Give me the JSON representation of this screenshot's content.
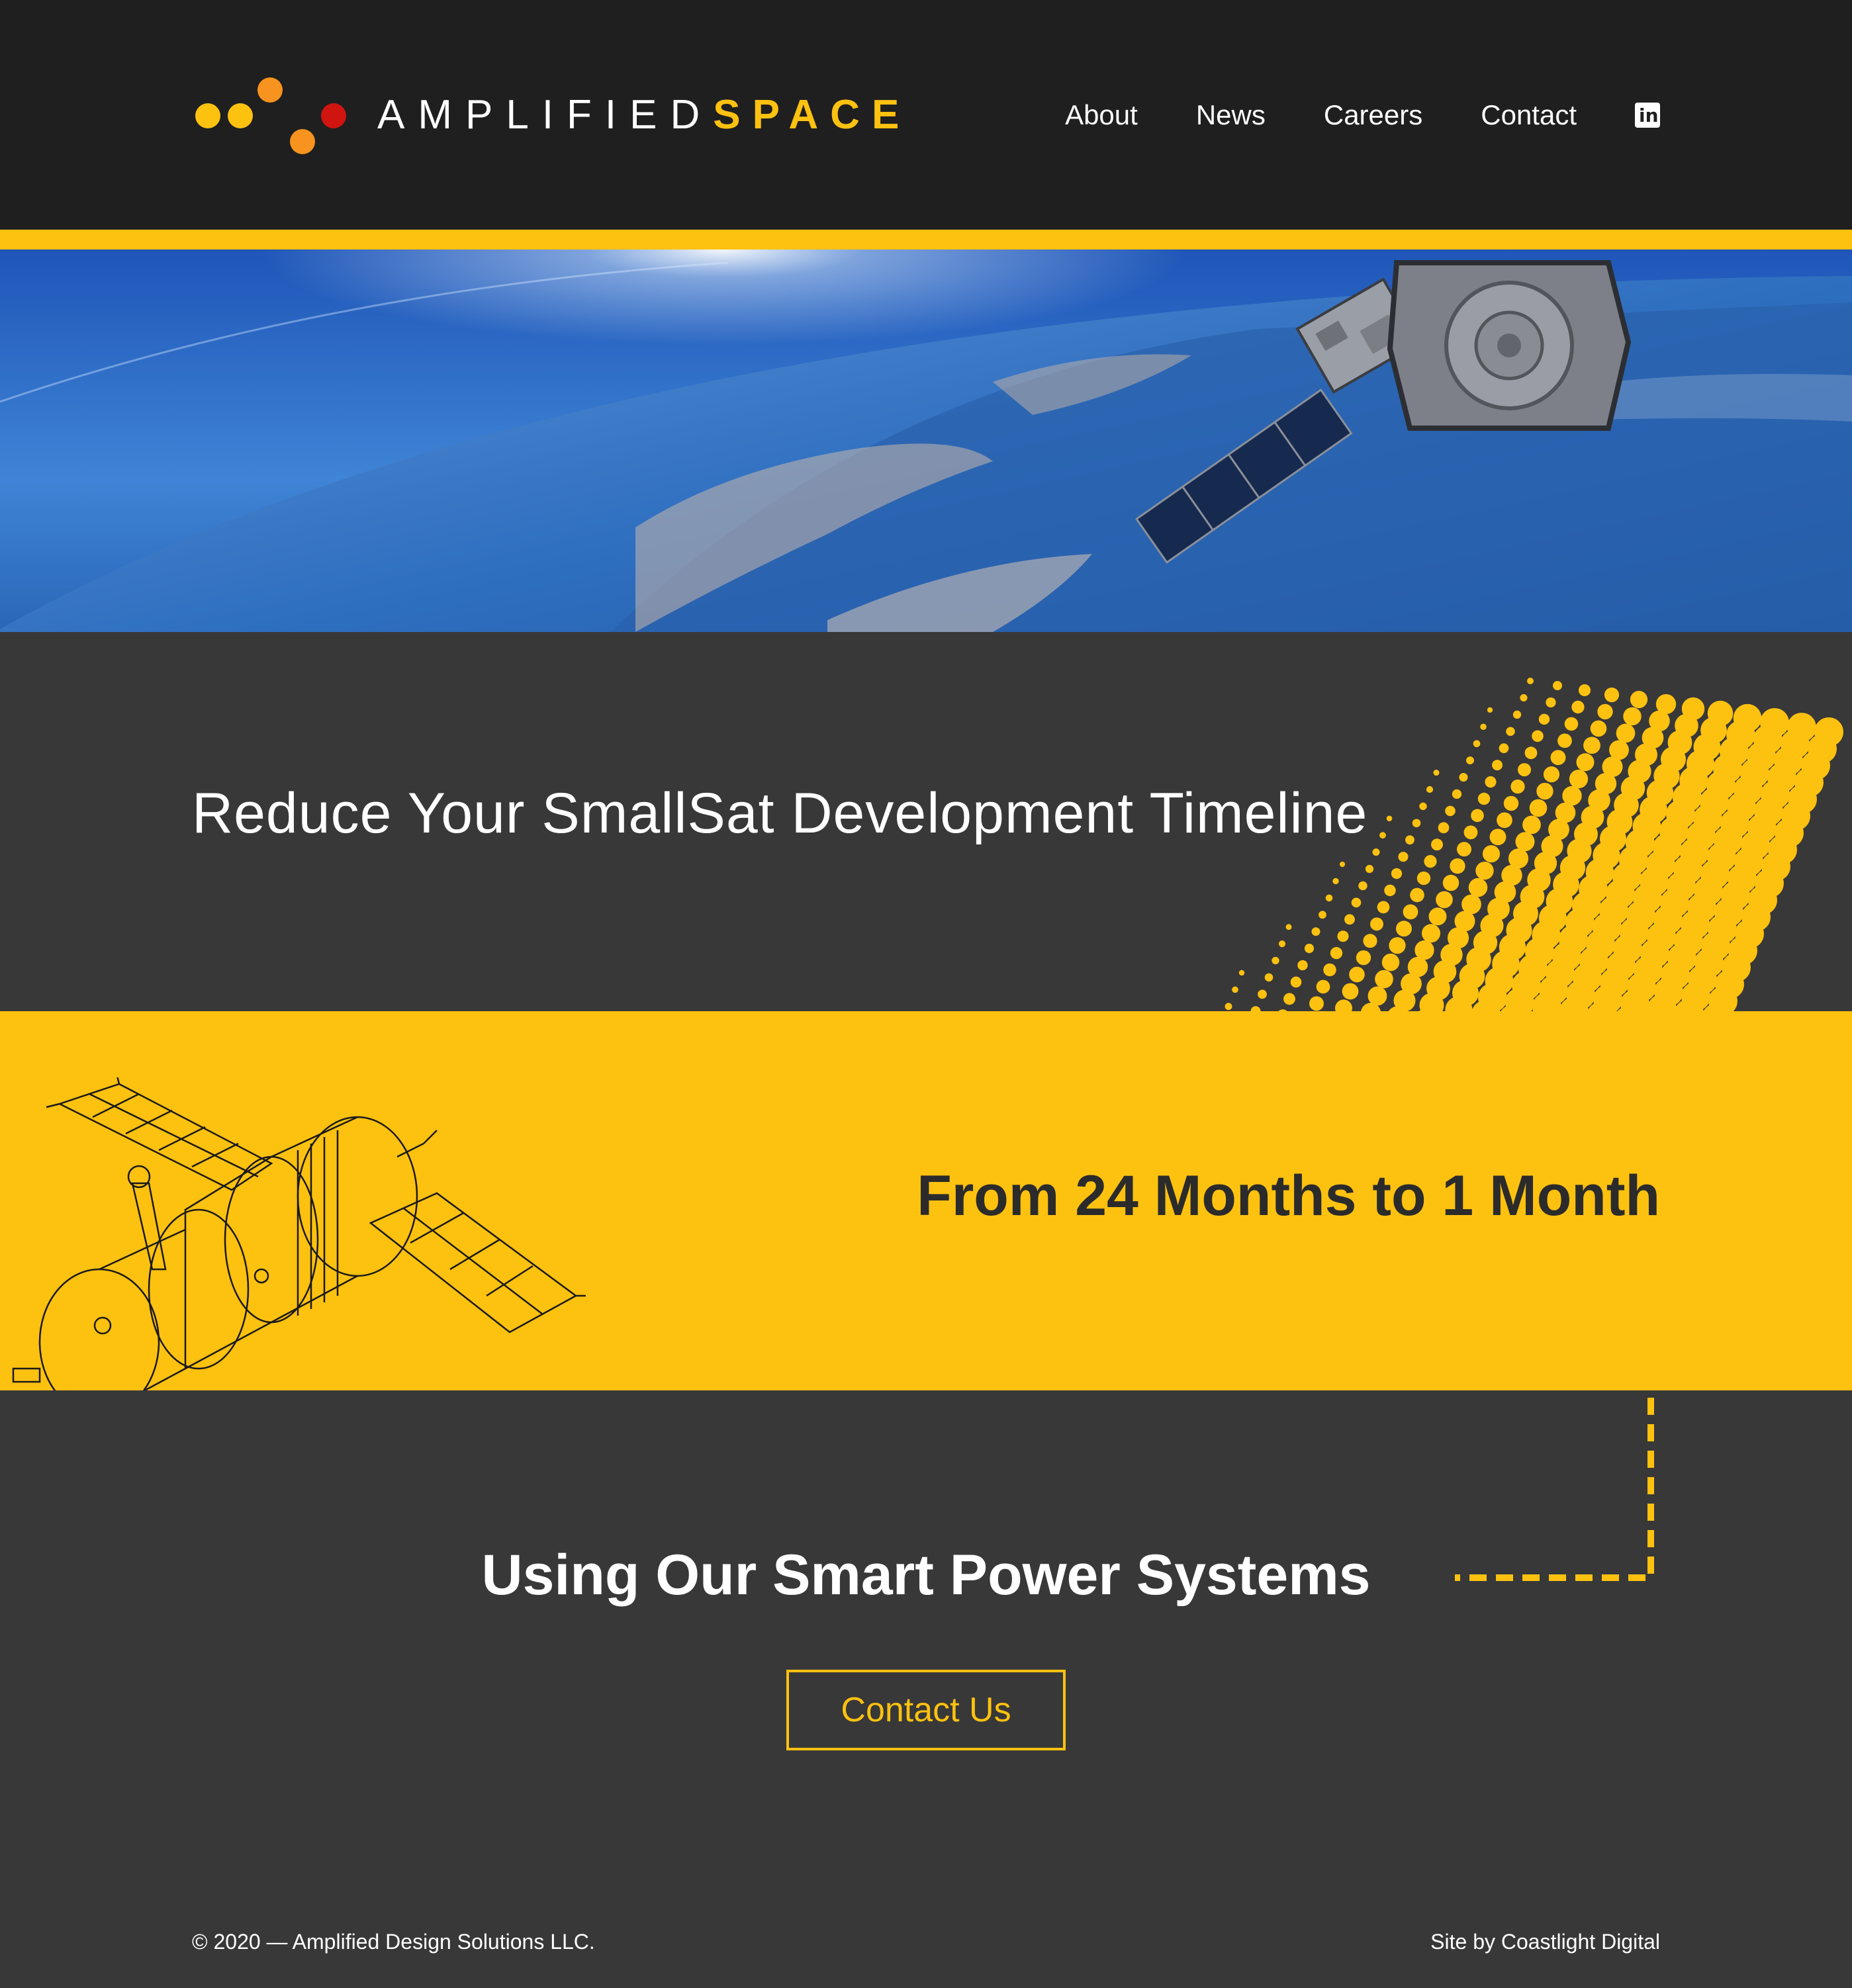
{
  "brand": {
    "word1": "AMPLIFIED",
    "word2": "SPACE",
    "accent_color": "#fdc110",
    "dot_colors": [
      "#fdc110",
      "#fdc110",
      "#f7931e",
      "#f7931e",
      "#d0140f"
    ]
  },
  "nav": {
    "items": [
      {
        "label": "About"
      },
      {
        "label": "News"
      },
      {
        "label": "Careers"
      },
      {
        "label": "Contact"
      }
    ],
    "social_icon": "linkedin-icon"
  },
  "hero": {
    "image": "satellite-over-earth"
  },
  "sections": {
    "headline_1": "Reduce Your SmallSat Development Timeline",
    "headline_2": "From 24 Months to 1 Month",
    "headline_3": "Using Our Smart Power Systems",
    "cta_label": "Contact Us"
  },
  "footer": {
    "copyright": "© 2020 — Amplified Design Solutions LLC.",
    "credit": "Site by Coastlight Digital"
  },
  "colors": {
    "header_bg": "#1f1f1f",
    "section_dark": "#383838",
    "section_yellow": "#fdc110"
  }
}
